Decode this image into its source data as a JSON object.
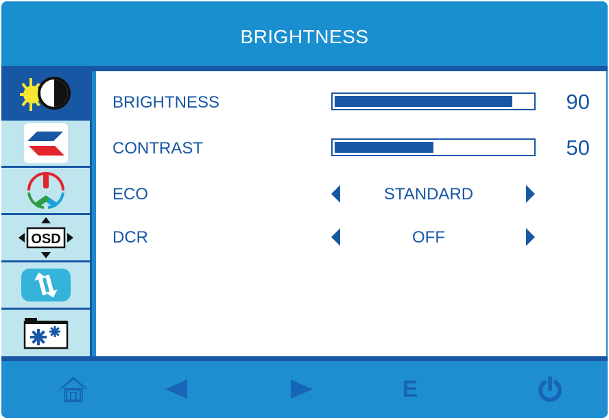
{
  "header": {
    "title": "BRIGHTNESS"
  },
  "sidebar": {
    "tabs": [
      {
        "icon": "brightness-contrast-icon",
        "active": true
      },
      {
        "icon": "image-icon",
        "active": false
      },
      {
        "icon": "color-icon",
        "active": false
      },
      {
        "icon": "osd-icon",
        "active": false,
        "label": "OSD"
      },
      {
        "icon": "reset-icon",
        "active": false
      },
      {
        "icon": "misc-settings-icon",
        "active": false
      }
    ]
  },
  "main": {
    "sliders": [
      {
        "label": "BRIGHTNESS",
        "value": "90",
        "fraction": 0.9
      },
      {
        "label": "CONTRAST",
        "value": "50",
        "fraction": 0.5
      }
    ],
    "selects": [
      {
        "label": "ECO",
        "value": "STANDARD"
      },
      {
        "label": "DCR",
        "value": "OFF"
      }
    ]
  },
  "footer": {
    "buttons": [
      {
        "icon": "home-icon"
      },
      {
        "icon": "left-arrow-icon"
      },
      {
        "icon": "right-arrow-icon"
      },
      {
        "icon": "exit-icon",
        "label": "E"
      },
      {
        "icon": "power-icon"
      }
    ]
  },
  "colors": {
    "primary": "#1857a4",
    "frame": "#1e8ccc",
    "tab_bg": "#bfe6ee",
    "footer_icon": "#1765b8"
  }
}
